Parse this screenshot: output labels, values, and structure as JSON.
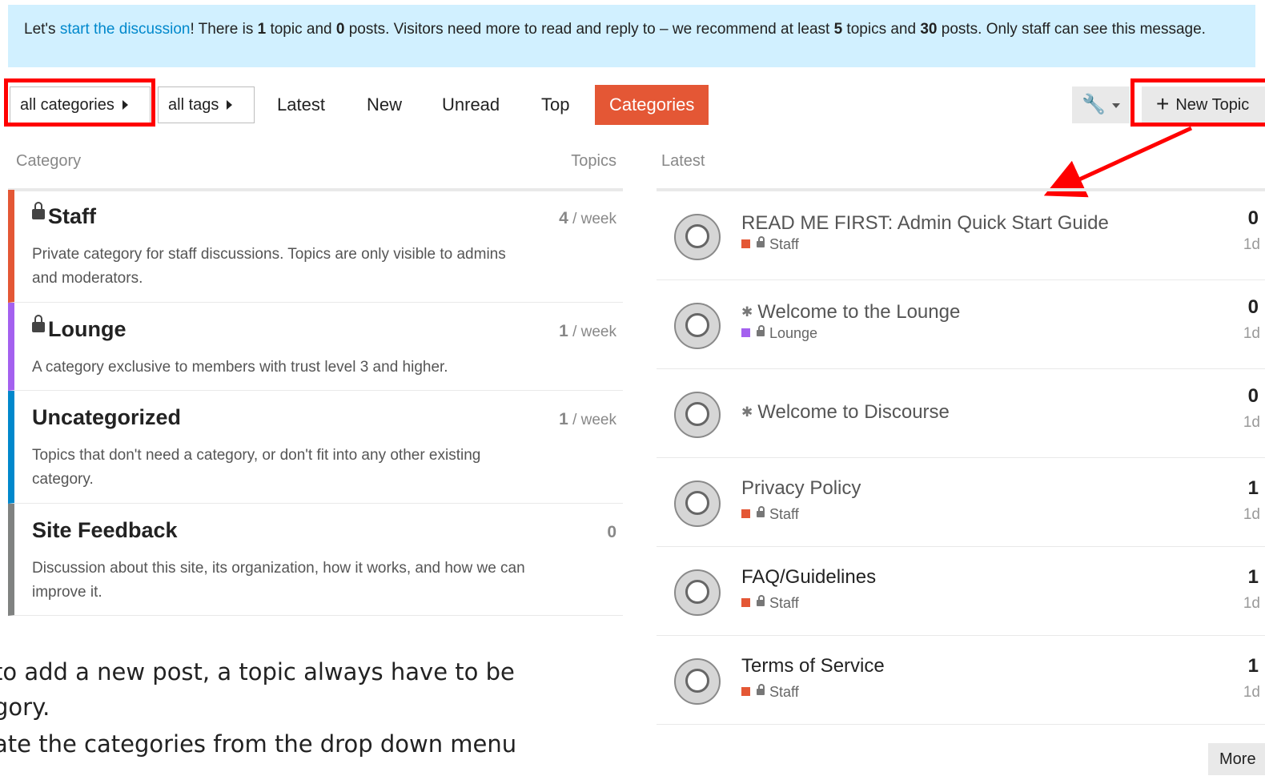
{
  "banner": {
    "prefix": "Let's ",
    "link": "start the discussion",
    "t1": "! There is ",
    "topics_n": "1",
    "t2": " topic and ",
    "posts_n": "0",
    "t3": " posts. Visitors need more to read and reply to – we recommend at least ",
    "rec_topics": "5",
    "t4": " topics and ",
    "rec_posts": "30",
    "t5": " posts. Only staff can see this message."
  },
  "nav": {
    "categories_dropdown": "all categories",
    "tags_dropdown": "all tags",
    "tabs": [
      "Latest",
      "New",
      "Unread",
      "Top",
      "Categories"
    ],
    "new_topic": "New Topic"
  },
  "category_list": {
    "col_category": "Category",
    "col_topics": "Topics",
    "items": [
      {
        "name": "Staff",
        "locked": true,
        "color": "#e45735",
        "desc": "Private category for staff discussions. Topics are only visible to admins and moderators.",
        "count": "4",
        "unit": " / week"
      },
      {
        "name": "Lounge",
        "locked": true,
        "color": "#a461ef",
        "desc": "A category exclusive to members with trust level 3 and higher.",
        "count": "1",
        "unit": " / week"
      },
      {
        "name": "Uncategorized",
        "locked": false,
        "color": "#0088cc",
        "desc": "Topics that don't need a category, or don't fit into any other existing category.",
        "count": "1",
        "unit": " / week"
      },
      {
        "name": "Site Feedback",
        "locked": false,
        "color": "#808281",
        "desc": "Discussion about this site, its organization, how it works, and how we can improve it.",
        "count": "0",
        "unit": ""
      }
    ]
  },
  "latest": {
    "heading": "Latest",
    "topics": [
      {
        "title": "READ ME FIRST: Admin Quick Start Guide",
        "category": "Staff",
        "cat_color": "#e45735",
        "replies": "0",
        "age": "1d"
      },
      {
        "title": "Welcome to the Lounge",
        "pinned": true,
        "category": "Lounge",
        "cat_color": "#a461ef",
        "replies": "0",
        "age": "1d"
      },
      {
        "title": "Welcome to Discourse",
        "pinned": true,
        "category": "",
        "cat_color": "",
        "replies": "0",
        "age": "1d"
      },
      {
        "title": "Privacy Policy",
        "category": "Staff",
        "cat_color": "#e45735",
        "replies": "1",
        "age": "1d"
      },
      {
        "title": "FAQ/Guidelines",
        "category": "Staff",
        "cat_color": "#e45735",
        "replies": "1",
        "age": "1d"
      },
      {
        "title": "Terms of Service",
        "category": "Staff",
        "cat_color": "#e45735",
        "replies": "1",
        "age": "1d"
      }
    ],
    "more": "More"
  },
  "notes": [
    "to add a new post, a topic always have to be",
    "gory.",
    "ate the categories from the drop down menu"
  ],
  "colors": {
    "annotation": "#ff0000",
    "active_tab": "#e45735",
    "banner_bg": "#d1f0ff",
    "link": "#0088cc"
  }
}
